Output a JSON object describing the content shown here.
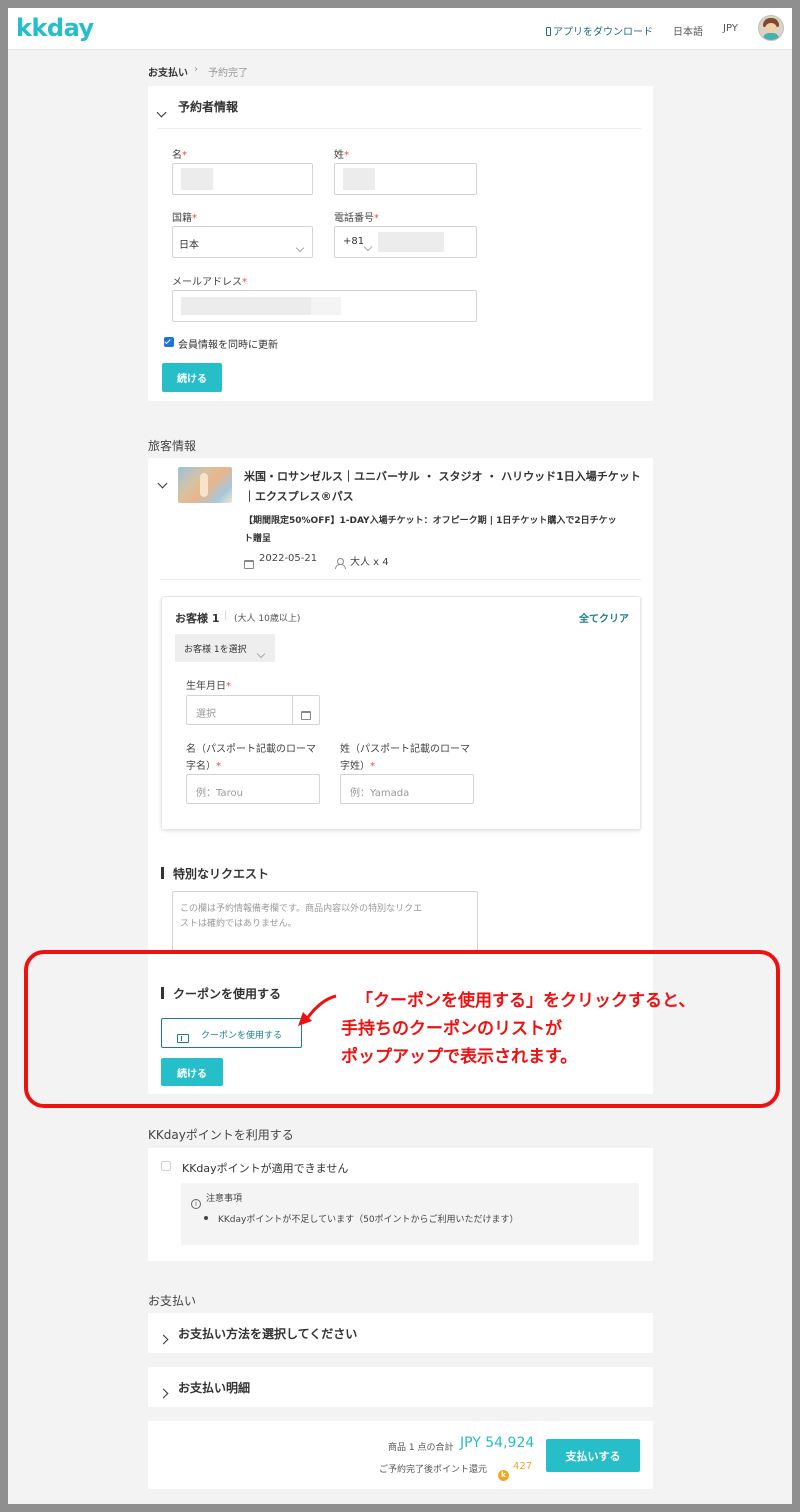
{
  "header": {
    "logo": "kkday",
    "app_download": "アプリをダウンロード",
    "language": "日本語",
    "currency": "JPY"
  },
  "breadcrumb": {
    "current": "お支払い",
    "separator": "›",
    "next": "予約完了"
  },
  "booker": {
    "title": "予約者情報",
    "first_name_label": "名",
    "last_name_label": "姓",
    "nationality_label": "国籍",
    "nationality_value": "日本",
    "phone_label": "電話番号",
    "phone_code": "+81",
    "email_label": "メールアドレス",
    "required_mark": "*",
    "update_member_label": "会員情報を同時に更新",
    "update_member_checked": true,
    "continue_button": "続ける"
  },
  "traveler": {
    "section_title": "旅客情報",
    "product_title_line1": "米国・ロサンゼルス｜ユニバーサル ・ スタジオ ・ ハリウッド1日入場チケット",
    "product_title_line2": "｜エクスプレス®パス",
    "plan_line1": "【期間限定50%OFF】1-DAY入場チケット：オフピーク期 | 1日チケット購入で2日チケッ",
    "plan_line2": "ト贈呈",
    "date": "2022-05-21",
    "pax": "大人 x 4",
    "guest_title": "お客様 1",
    "guest_divider": "|",
    "guest_sub": "(大人 10歳以上)",
    "clear_all": "全てクリア",
    "guest_select": "お客様 1を選択",
    "birthday_label": "生年月日",
    "birthday_placeholder": "選択",
    "passport_first_label_line1": "名（パスポート記載のローマ",
    "passport_first_label_line2": "字名）",
    "passport_last_label_line1": "姓（パスポート記載のローマ",
    "passport_last_label_line2": "字姓）",
    "first_placeholder": "例：Tarou",
    "last_placeholder": "例：Yamada",
    "required_mark": "*"
  },
  "special_request": {
    "title": "特別なリクエスト",
    "placeholder_line1": "この欄は予約情報備考欄です。商品内容以外の特別なリクエ",
    "placeholder_line2": "ストは確約ではありません。"
  },
  "coupon": {
    "title": "クーポンを使用する",
    "button": "クーポンを使用する",
    "continue_button": "続ける",
    "annotation_line1": "「クーポンを使用する」をクリックすると、",
    "annotation_line2": "手持ちのクーポンのリストが",
    "annotation_line3": "ポップアップで表示されます。"
  },
  "points": {
    "section_title": "KKdayポイントを利用する",
    "unavailable": "KKdayポイントが適用できません",
    "notice_title": "注意事項",
    "notice_item": "KKdayポイントが不足しています（50ポイントからご利用いただけます）"
  },
  "payment": {
    "section_title": "お支払い",
    "method": "お支払い方法を選択してください",
    "details": "お支払い明細",
    "total_label": "商品 1 点の合計",
    "total_value": "JPY 54,924",
    "points_label": "ご予約完了後ポイント還元",
    "points_value": "427",
    "pay_button": "支払いする"
  },
  "colors": {
    "brand_teal": "#26bec9",
    "annotation_red": "#ee1111",
    "coin": "#f5a623"
  }
}
